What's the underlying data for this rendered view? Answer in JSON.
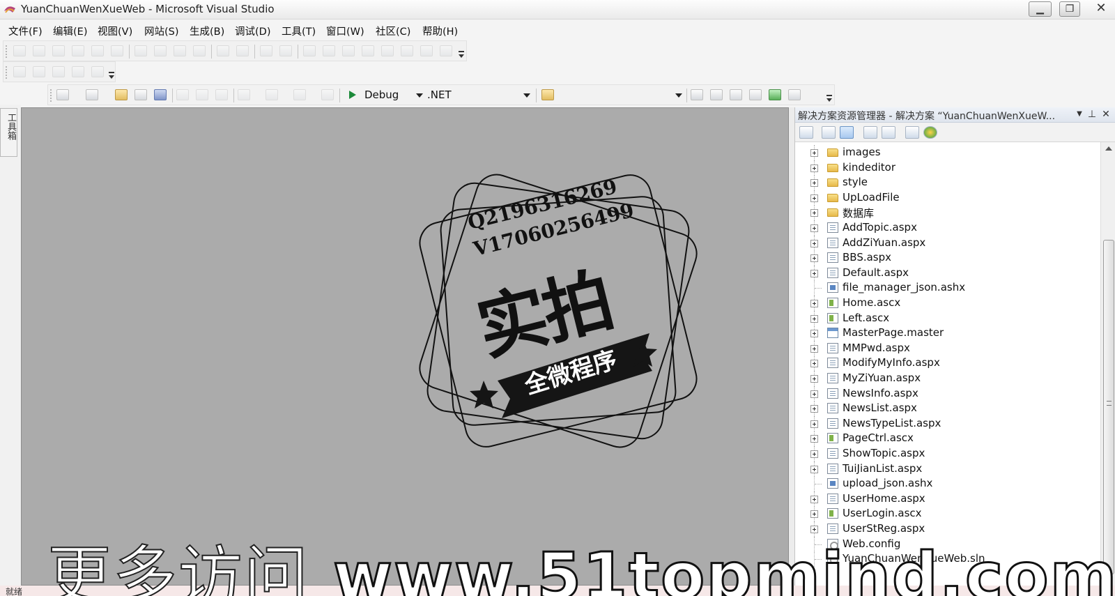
{
  "window": {
    "title": "YuanChuanWenXueWeb - Microsoft Visual Studio",
    "min_glyph": "▁",
    "max_glyph": "❐",
    "close_glyph": "✕"
  },
  "menu": [
    "文件(F)",
    "编辑(E)",
    "视图(V)",
    "网站(S)",
    "生成(B)",
    "调试(D)",
    "工具(T)",
    "窗口(W)",
    "社区(C)",
    "帮助(H)"
  ],
  "toolbar": {
    "config": "Debug",
    "platform": ".NET",
    "third_combo": ""
  },
  "toolbox": {
    "label": "工具箱"
  },
  "solution_explorer": {
    "title": "解决方案资源管理器 - 解决方案 “YuanChuanWenXueW...",
    "pin_glyph": "▼",
    "autohide_glyph": "⊥",
    "close_glyph": "✕",
    "items": [
      {
        "label": "images",
        "icon": "folder",
        "expandable": true
      },
      {
        "label": "kindeditor",
        "icon": "folder",
        "expandable": true
      },
      {
        "label": "style",
        "icon": "folder",
        "expandable": true
      },
      {
        "label": "UpLoadFile",
        "icon": "folder",
        "expandable": true
      },
      {
        "label": "数据库",
        "icon": "folder",
        "expandable": true
      },
      {
        "label": "AddTopic.aspx",
        "icon": "page",
        "expandable": true
      },
      {
        "label": "AddZiYuan.aspx",
        "icon": "page",
        "expandable": true
      },
      {
        "label": "BBS.aspx",
        "icon": "page",
        "expandable": true
      },
      {
        "label": "Default.aspx",
        "icon": "page",
        "expandable": true
      },
      {
        "label": "file_manager_json.ashx",
        "icon": "ashx",
        "expandable": false
      },
      {
        "label": "Home.ascx",
        "icon": "ascx",
        "expandable": true
      },
      {
        "label": "Left.ascx",
        "icon": "ascx",
        "expandable": true
      },
      {
        "label": "MasterPage.master",
        "icon": "master",
        "expandable": true
      },
      {
        "label": "MMPwd.aspx",
        "icon": "page",
        "expandable": true
      },
      {
        "label": "ModifyMyInfo.aspx",
        "icon": "page",
        "expandable": true
      },
      {
        "label": "MyZiYuan.aspx",
        "icon": "page",
        "expandable": true
      },
      {
        "label": "NewsInfo.aspx",
        "icon": "page",
        "expandable": true
      },
      {
        "label": "NewsList.aspx",
        "icon": "page",
        "expandable": true
      },
      {
        "label": "NewsTypeList.aspx",
        "icon": "page",
        "expandable": true
      },
      {
        "label": "PageCtrl.ascx",
        "icon": "ascx",
        "expandable": true
      },
      {
        "label": "ShowTopic.aspx",
        "icon": "page",
        "expandable": true
      },
      {
        "label": "TuiJianList.aspx",
        "icon": "page",
        "expandable": true
      },
      {
        "label": "upload_json.ashx",
        "icon": "ashx",
        "expandable": false
      },
      {
        "label": "UserHome.aspx",
        "icon": "page",
        "expandable": true
      },
      {
        "label": "UserLogin.ascx",
        "icon": "ascx",
        "expandable": true
      },
      {
        "label": "UserStReg.aspx",
        "icon": "page",
        "expandable": true
      },
      {
        "label": "Web.config",
        "icon": "config",
        "expandable": false
      },
      {
        "label": "YuanChuanWenXueWeb.sln",
        "icon": "config",
        "expandable": false
      }
    ]
  },
  "stamp": {
    "line1": "Q2196316269",
    "line2": "V17060256499",
    "big": "实拍",
    "banner": "全微程序"
  },
  "watermark": {
    "zh": "更多访问",
    "url": "www.51topmind.com"
  },
  "status": {
    "text": "就绪"
  }
}
